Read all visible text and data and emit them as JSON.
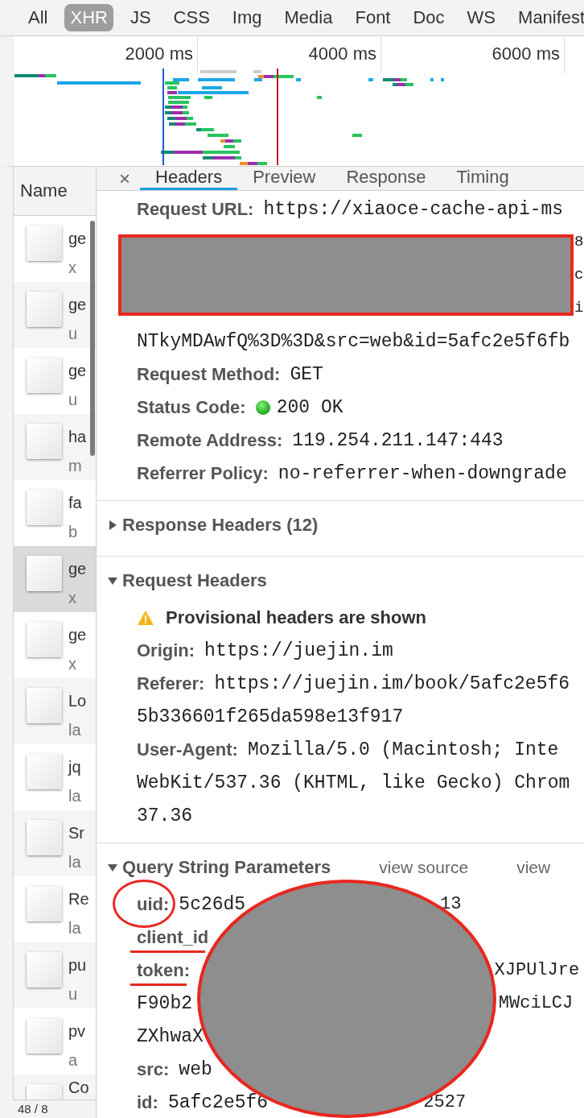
{
  "filter_bar": {
    "types": [
      {
        "label": "All",
        "selected": false
      },
      {
        "label": "XHR",
        "selected": true
      },
      {
        "label": "JS",
        "selected": false
      },
      {
        "label": "CSS",
        "selected": false
      },
      {
        "label": "Img",
        "selected": false
      },
      {
        "label": "Media",
        "selected": false
      },
      {
        "label": "Font",
        "selected": false
      },
      {
        "label": "Doc",
        "selected": false
      },
      {
        "label": "WS",
        "selected": false
      },
      {
        "label": "Manifest",
        "selected": false
      }
    ]
  },
  "overview": {
    "ticks": [
      "2000 ms",
      "4000 ms",
      "6000 ms"
    ]
  },
  "requests": {
    "header": "Name",
    "rows": [
      {
        "name": "ge",
        "detail": "x",
        "selected": false
      },
      {
        "name": "ge",
        "detail": "u",
        "selected": false
      },
      {
        "name": "ge",
        "detail": "u",
        "selected": false
      },
      {
        "name": "ha",
        "detail": "m",
        "selected": false
      },
      {
        "name": "fa",
        "detail": "b",
        "selected": false
      },
      {
        "name": "ge",
        "detail": "x",
        "selected": true
      },
      {
        "name": "ge",
        "detail": "x",
        "selected": false
      },
      {
        "name": "Lo",
        "detail": "la",
        "selected": false
      },
      {
        "name": "jq",
        "detail": "la",
        "selected": false
      },
      {
        "name": "Sr",
        "detail": "la",
        "selected": false
      },
      {
        "name": "Re",
        "detail": "la",
        "selected": false
      },
      {
        "name": "pu",
        "detail": "u",
        "selected": false
      },
      {
        "name": "pv",
        "detail": "a",
        "selected": false
      },
      {
        "name": "Co",
        "selected": false
      }
    ],
    "footer": "48 / 8"
  },
  "details": {
    "close": "×",
    "tabs": [
      {
        "label": "Headers",
        "selected": true
      },
      {
        "label": "Preview",
        "selected": false
      },
      {
        "label": "Response",
        "selected": false
      },
      {
        "label": "Timing",
        "selected": false
      }
    ],
    "general": [
      {
        "kind": "field",
        "label": "Request URL:",
        "value": "https://xiaoce-cache-api-ms"
      },
      {
        "kind": "redacted",
        "fragments": [
          "8",
          "c",
          "i"
        ]
      },
      {
        "kind": "line",
        "value": "NTkyMDAwfQ%3D%3D&src=web&id=5afc2e5f6fb"
      },
      {
        "kind": "field",
        "label": "Request Method:",
        "value": "GET"
      },
      {
        "kind": "status",
        "label": "Status Code:",
        "value": "200 OK"
      },
      {
        "kind": "field",
        "label": "Remote Address:",
        "value": "119.254.211.147:443"
      },
      {
        "kind": "field",
        "label": "Referrer Policy:",
        "value": "no-referrer-when-downgrade"
      }
    ],
    "sections": [
      {
        "title": "Response Headers (12)",
        "expanded": false
      },
      {
        "title": "Request Headers",
        "expanded": true,
        "rows": [
          {
            "kind": "warning",
            "value": "Provisional headers are shown"
          },
          {
            "kind": "field",
            "label": "Origin:",
            "value": "https://juejin.im"
          },
          {
            "kind": "field",
            "label": "Referer:",
            "value": "https://juejin.im/book/5afc2e5f6"
          },
          {
            "kind": "line",
            "value": "5b336601f265da598e13f917"
          },
          {
            "kind": "field",
            "label": "User-Agent:",
            "value": "Mozilla/5.0 (Macintosh; Inte"
          },
          {
            "kind": "line",
            "value": "WebKit/537.36 (KHTML, like Gecko) Chrom"
          },
          {
            "kind": "line",
            "value": "37.36"
          }
        ]
      },
      {
        "title": "Query String Parameters",
        "expanded": true,
        "links": [
          "view source",
          "view"
        ],
        "rows": [
          {
            "kind": "field",
            "label": "uid:",
            "value": "5c26d5",
            "tail": "13",
            "circled": true
          },
          {
            "kind": "field",
            "label": "client_id",
            "underlined": true
          },
          {
            "kind": "field",
            "label": "token:",
            "tail": "XJPUlJre",
            "underlined": true
          },
          {
            "kind": "line",
            "value": "F90b2",
            "tail": "MWciLCJ"
          },
          {
            "kind": "line",
            "value": "ZXhwaX"
          },
          {
            "kind": "field",
            "label": "src:",
            "value": "web"
          },
          {
            "kind": "field",
            "label": "id:",
            "value": "5afc2e5f6",
            "tail": "2527"
          }
        ]
      }
    ]
  }
}
